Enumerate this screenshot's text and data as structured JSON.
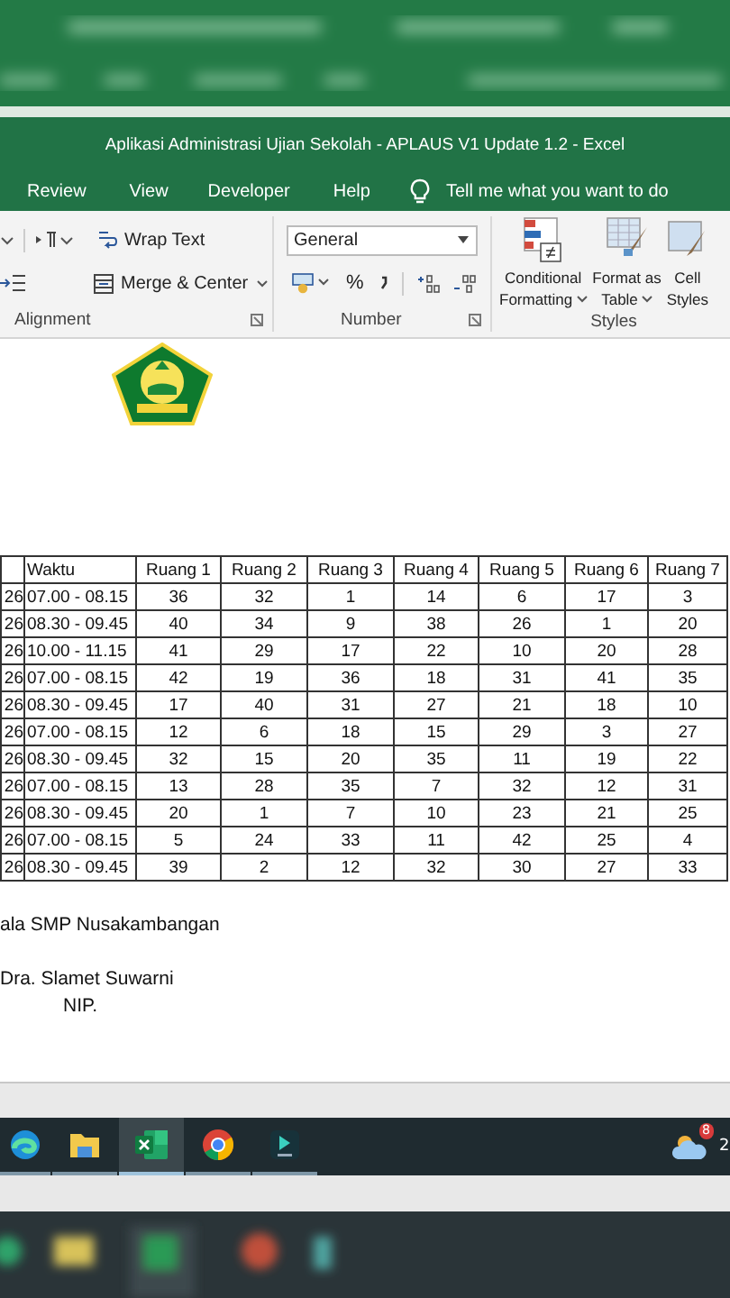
{
  "window": {
    "title": "Aplikasi Administrasi Ujian Sekolah - APLAUS V1 Update 1.2  -  Excel"
  },
  "menu_tabs": [
    "Review",
    "View",
    "Developer",
    "Help"
  ],
  "tell_me": "Tell me what you want to do",
  "ribbon": {
    "alignment": {
      "label": "Alignment",
      "wrap_text": "Wrap Text",
      "merge": "Merge & Center"
    },
    "number": {
      "label": "Number",
      "format": "General",
      "percent": "%"
    },
    "styles": {
      "label": "Styles",
      "buttons": [
        {
          "kind": "conditional",
          "lines": [
            "Conditional",
            "Formatting"
          ],
          "dropdown": true
        },
        {
          "kind": "table",
          "lines": [
            "Format as",
            "Table"
          ],
          "dropdown": true
        },
        {
          "kind": "cell",
          "lines": [
            "Cell",
            "Styles"
          ],
          "dropdown": false
        }
      ]
    }
  },
  "table": {
    "columns": [
      "",
      "Waktu",
      "Ruang 1",
      "Ruang 2",
      "Ruang 3",
      "Ruang 4",
      "Ruang 5",
      "Ruang 6",
      "Ruang 7"
    ],
    "rows": [
      [
        "26",
        "07.00 - 08.15",
        "36",
        "32",
        "1",
        "14",
        "6",
        "17",
        "3"
      ],
      [
        "26",
        "08.30 - 09.45",
        "40",
        "34",
        "9",
        "38",
        "26",
        "1",
        "20"
      ],
      [
        "26",
        "10.00 - 11.15",
        "41",
        "29",
        "17",
        "22",
        "10",
        "20",
        "28"
      ],
      [
        "26",
        "07.00 - 08.15",
        "42",
        "19",
        "36",
        "18",
        "31",
        "41",
        "35"
      ],
      [
        "26",
        "08.30 - 09.45",
        "17",
        "40",
        "31",
        "27",
        "21",
        "18",
        "10"
      ],
      [
        "26",
        "07.00 - 08.15",
        "12",
        "6",
        "18",
        "15",
        "29",
        "3",
        "27"
      ],
      [
        "26",
        "08.30 - 09.45",
        "32",
        "15",
        "20",
        "35",
        "11",
        "19",
        "22"
      ],
      [
        "26",
        "07.00 - 08.15",
        "13",
        "28",
        "35",
        "7",
        "32",
        "12",
        "31"
      ],
      [
        "26",
        "08.30 - 09.45",
        "20",
        "1",
        "7",
        "10",
        "23",
        "21",
        "25"
      ],
      [
        "26",
        "07.00 - 08.15",
        "5",
        "24",
        "33",
        "11",
        "42",
        "25",
        "4"
      ],
      [
        "26",
        "08.30 - 09.45",
        "39",
        "2",
        "12",
        "32",
        "30",
        "27",
        "33"
      ]
    ]
  },
  "signature": {
    "office": "ala SMP Nusakambangan",
    "name": "Dra. Slamet Suwarni",
    "nip": "NIP."
  },
  "taskbar": {
    "apps": [
      {
        "kind": "edge",
        "selected": false
      },
      {
        "kind": "folder",
        "selected": false
      },
      {
        "kind": "excel",
        "selected": true
      },
      {
        "kind": "chrome",
        "selected": false
      },
      {
        "kind": "arrow",
        "selected": false
      }
    ],
    "weather_badge": "8",
    "clock": "2"
  }
}
